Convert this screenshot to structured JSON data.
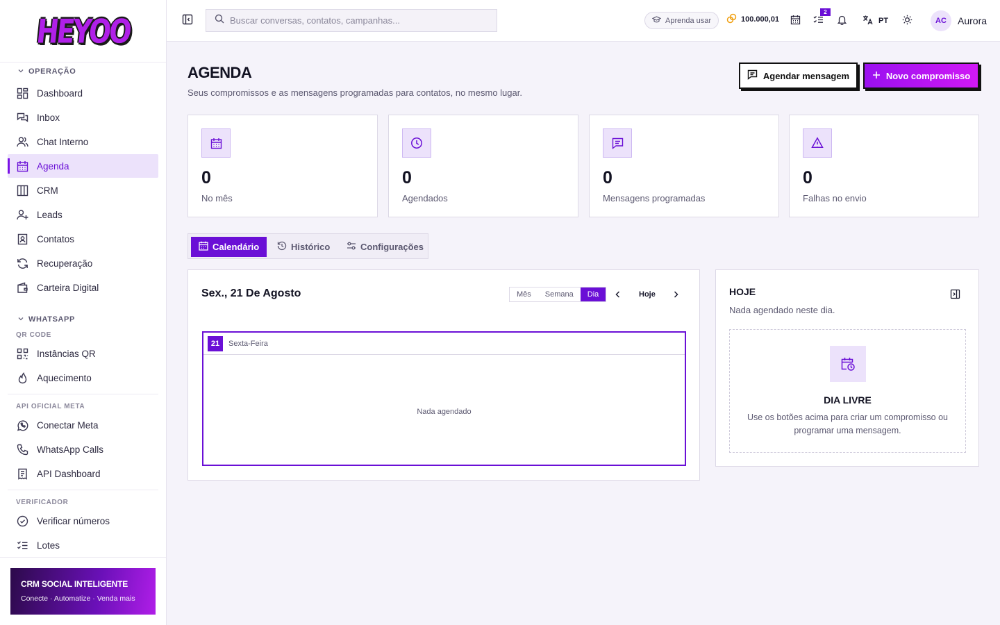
{
  "brand": {
    "logo_text": "HEYOO",
    "accent": "#6a0fd6",
    "accent_light": "#ece2fb"
  },
  "sidebar": {
    "sections": {
      "operacao": "OPERAÇÃO",
      "whatsapp": "WHATSAPP",
      "qr_code": "QR CODE",
      "api_meta": "API OFICIAL META",
      "verificador": "VERIFICADOR"
    },
    "items": {
      "dashboard": "Dashboard",
      "inbox": "Inbox",
      "chat_interno": "Chat Interno",
      "agenda": "Agenda",
      "crm": "CRM",
      "leads": "Leads",
      "contatos": "Contatos",
      "recuperacao": "Recuperação",
      "carteira": "Carteira Digital",
      "instancias_qr": "Instâncias QR",
      "aquecimento": "Aquecimento",
      "conectar_meta": "Conectar Meta",
      "whatsapp_calls": "WhatsApp Calls",
      "api_dashboard": "API Dashboard",
      "verificar_numeros": "Verificar números",
      "lotes": "Lotes"
    },
    "active": "agenda",
    "promo": {
      "title": "CRM SOCIAL INTELIGENTE",
      "subtitle": "Conecte · Automatize · Venda mais"
    }
  },
  "topbar": {
    "search_placeholder": "Buscar conversas, contatos, campanhas...",
    "learn_label": "Aprenda usar",
    "coins": "100.000,01",
    "tasks_badge": "2",
    "language": "PT",
    "user": {
      "initials": "AC",
      "name": "Aurora"
    }
  },
  "page": {
    "title": "AGENDA",
    "subtitle": "Seus compromissos e as mensagens programadas para contatos, no mesmo lugar.",
    "btn_schedule": "Agendar mensagem",
    "btn_new": "Novo compromisso"
  },
  "stats": [
    {
      "value": "0",
      "label": "No mês",
      "icon": "calendar-icon"
    },
    {
      "value": "0",
      "label": "Agendados",
      "icon": "clock-icon"
    },
    {
      "value": "0",
      "label": "Mensagens programadas",
      "icon": "message-icon"
    },
    {
      "value": "0",
      "label": "Falhas no envio",
      "icon": "alert-icon"
    }
  ],
  "tabs": {
    "calendar": "Calendário",
    "history": "Histórico",
    "settings": "Configurações",
    "active": "calendar"
  },
  "calendar": {
    "date_title": "Sex., 21 De Agosto",
    "views": {
      "month": "Mês",
      "week": "Semana",
      "day": "Dia"
    },
    "active_view": "day",
    "today_label": "Hoje",
    "day_number": "21",
    "day_name": "Sexta-Feira",
    "empty": "Nada agendado"
  },
  "today_panel": {
    "title": "HOJE",
    "subtitle": "Nada agendado neste dia.",
    "free_title": "DIA LIVRE",
    "free_desc": "Use os botões acima para criar um compromisso ou programar uma mensagem."
  }
}
